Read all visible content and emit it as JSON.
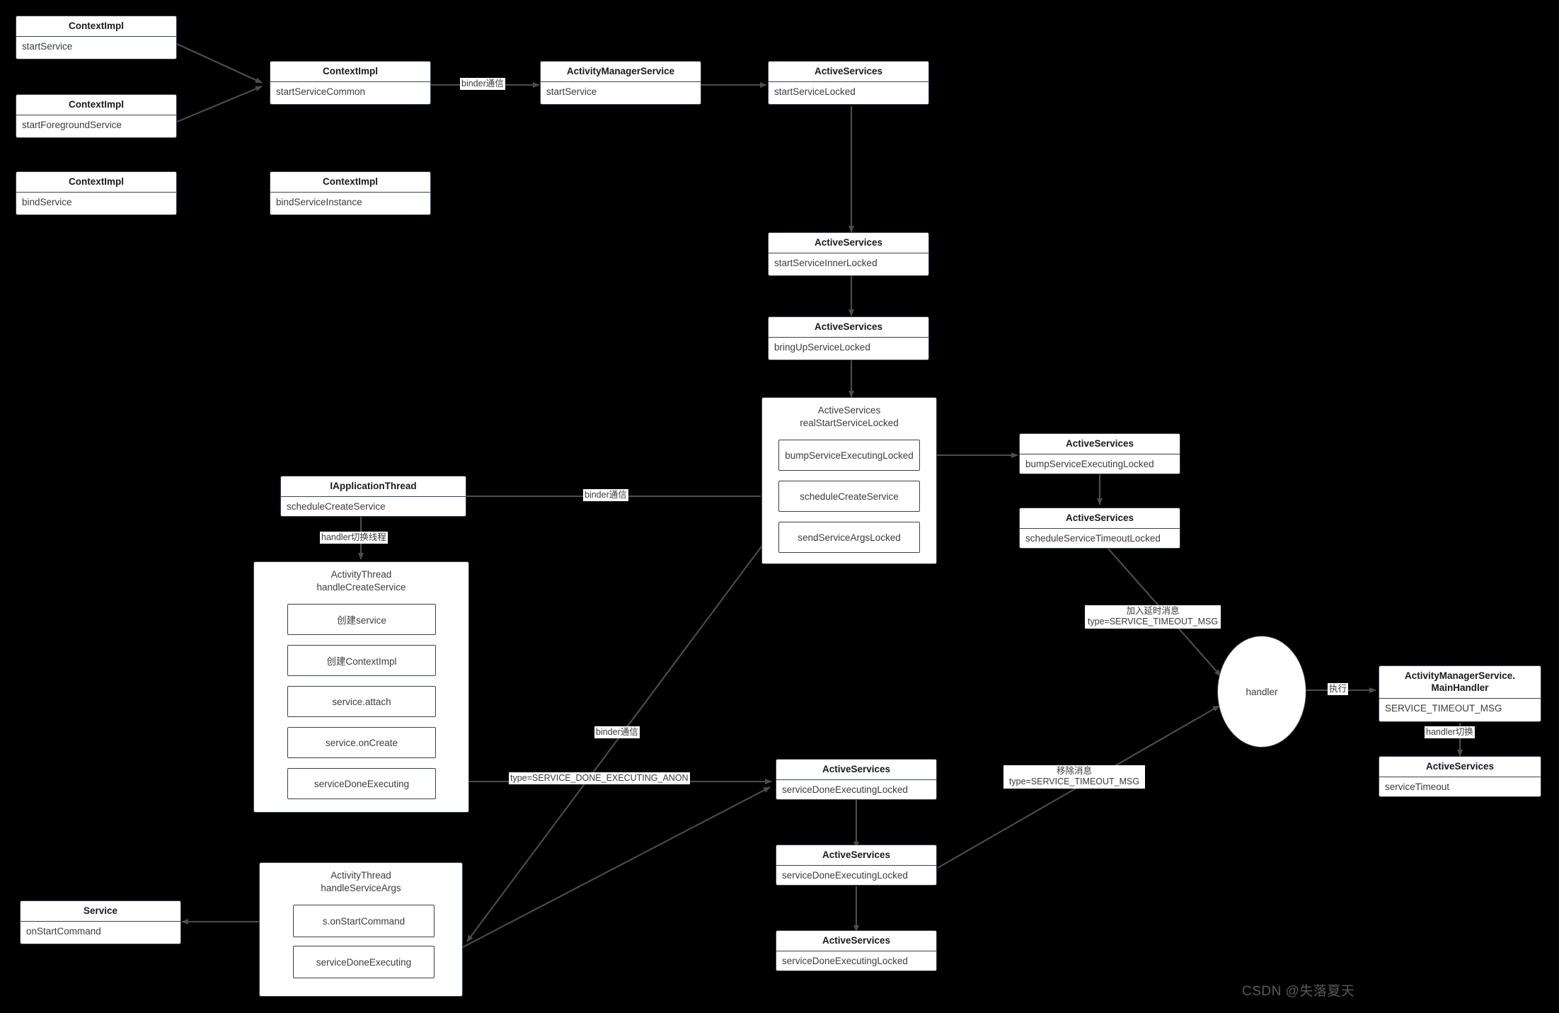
{
  "diagram": {
    "title": "Android Service startup call flow",
    "background_color": "#000000",
    "node_fill": "#ffffff",
    "node_stroke": "#36424f",
    "edge_color": "#4d4d4d",
    "watermark": "CSDN @失落夏天"
  },
  "nodes": {
    "ctx_start_service": {
      "title": "ContextImpl",
      "body": "startService"
    },
    "ctx_start_fg_service": {
      "title": "ContextImpl",
      "body": "startForegroundService"
    },
    "ctx_bind_service": {
      "title": "ContextImpl",
      "body": "bindService"
    },
    "ctx_start_service_common": {
      "title": "ContextImpl",
      "body": "startServiceCommon"
    },
    "ctx_bind_service_instance": {
      "title": "ContextImpl",
      "body": "bindServiceInstance"
    },
    "ams_start_service": {
      "title": "ActivityManagerService",
      "body": "startService"
    },
    "as_start_service_locked": {
      "title": "ActiveServices",
      "body": "startServiceLocked"
    },
    "as_start_inner_locked": {
      "title": "ActiveServices",
      "body": "startServiceInnerLocked"
    },
    "as_bring_up_locked": {
      "title": "ActiveServices",
      "body": "bringUpServiceLocked"
    },
    "as_bump_exec_locked": {
      "title": "ActiveServices",
      "body": "bumpServiceExecutingLocked"
    },
    "as_sched_timeout_locked": {
      "title": "ActiveServices",
      "body": "scheduleServiceTimeoutLocked"
    },
    "iapp_thread": {
      "title": "IApplicationThread",
      "body": "scheduleCreateService"
    },
    "as_done_exec_locked_1": {
      "title": "ActiveServices",
      "body": "serviceDoneExecutingLocked"
    },
    "as_done_exec_locked_2": {
      "title": "ActiveServices",
      "body": "serviceDoneExecutingLocked"
    },
    "as_done_exec_locked_3": {
      "title": "ActiveServices",
      "body": "serviceDoneExecutingLocked"
    },
    "ams_main_handler": {
      "title": "ActivityManagerService.\nMainHandler",
      "body": "SERVICE_TIMEOUT_MSG"
    },
    "as_service_timeout": {
      "title": "ActiveServices",
      "body": "serviceTimeout"
    },
    "service_on_start_command": {
      "title": "Service",
      "body": "onStartCommand"
    },
    "handler_node": {
      "label": "handler"
    }
  },
  "groups": {
    "real_start_service_locked": {
      "title": "ActiveServices\nrealStartServiceLocked",
      "steps": [
        "bumpServiceExecutingLocked",
        "scheduleCreateService",
        "sendServiceArgsLocked"
      ]
    },
    "handle_create_service": {
      "title": "ActivityThread\nhandleCreateService",
      "steps": [
        "创建service",
        "创建ContextImpl",
        "service.attach",
        "service.onCreate",
        "serviceDoneExecuting"
      ]
    },
    "handle_service_args": {
      "title": "ActivityThread\nhandleServiceArgs",
      "steps": [
        "s.onStartCommand",
        "serviceDoneExecuting"
      ]
    }
  },
  "edge_labels": {
    "binder_top": "binder通信",
    "binder_schedule_create": "binder通信",
    "binder_send_args": "binder通信",
    "handler_switch_thread": "handler切换线程",
    "service_done_executing_anon": "type=SERVICE_DONE_EXECUTING_ANON",
    "add_delay_msg": "加入延时消息\ntype=SERVICE_TIMEOUT_MSG",
    "remove_msg": "移除消息\ntype=SERVICE_TIMEOUT_MSG",
    "execute": "执行",
    "handler_switch": "handler切换"
  }
}
